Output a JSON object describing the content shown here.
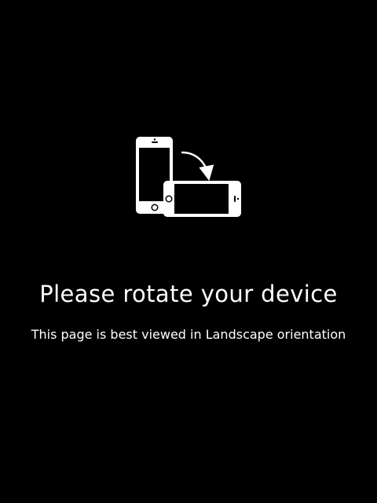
{
  "orientation_notice": {
    "title": "Please rotate your device",
    "message": "This page is best viewed in Landscape orientation",
    "icon": "rotate-device-icon",
    "colors": {
      "background": "#000000",
      "foreground": "#ffffff"
    }
  }
}
